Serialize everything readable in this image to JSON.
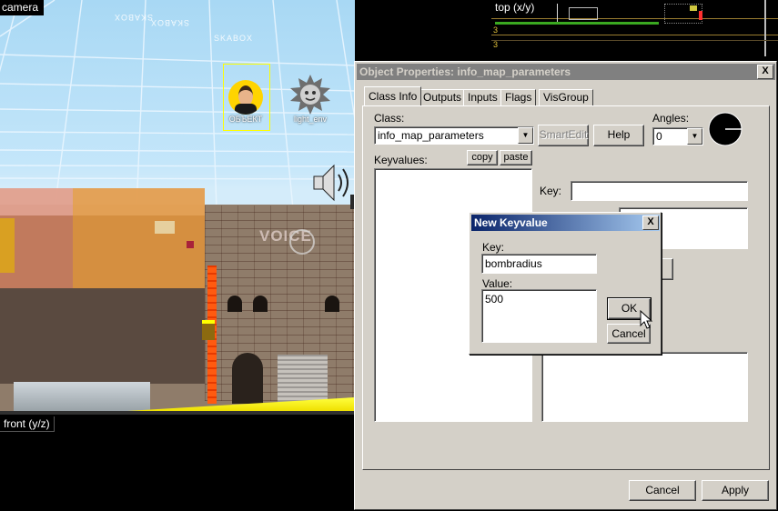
{
  "viewports": {
    "camera": {
      "label": "camera"
    },
    "top": {
      "label": "top (x/y)"
    },
    "front": {
      "label": "front (y/z)"
    }
  },
  "sky_text": {
    "skybox": "SKABOX"
  },
  "entities": {
    "selected_entity_label": "ОБЪЕКТ",
    "light_env_label": "light_env"
  },
  "graffiti": {
    "text": "VOICE"
  },
  "object_properties": {
    "title": "Object Properties: info_map_parameters",
    "close": "X",
    "tabs": [
      {
        "label": "Class Info"
      },
      {
        "label": "Outputs"
      },
      {
        "label": "Inputs"
      },
      {
        "label": "Flags"
      },
      {
        "label": "VisGroup"
      }
    ],
    "class_label": "Class:",
    "class_value": "info_map_parameters",
    "smartedit_label": "SmartEdit",
    "help_label": "Help",
    "angles_label": "Angles:",
    "angles_value": "0",
    "keyvalues_label": "Keyvalues:",
    "copy_label": "copy",
    "paste_label": "paste",
    "key_label": "Key:",
    "key_value": "",
    "cancel_label": "Cancel",
    "apply_label": "Apply"
  },
  "new_keyvalue": {
    "title": "New Keyvalue",
    "close": "X",
    "key_label": "Key:",
    "key_value": "bombradius",
    "value_label": "Value:",
    "value_value": "500",
    "ok_label": "OK",
    "cancel_label": "Cancel"
  },
  "colors": {
    "titlebar_active": "#0a246a",
    "titlebar_inactive": "#808080",
    "dialog_face": "#d4d0c8",
    "selection_yellow": "#ffff00"
  },
  "icons": [
    "arrow-cursor-icon",
    "light-env-sun-icon",
    "speaker-icon",
    "dropdown-arrow-icon",
    "angle-dial-icon",
    "close-icon"
  ]
}
